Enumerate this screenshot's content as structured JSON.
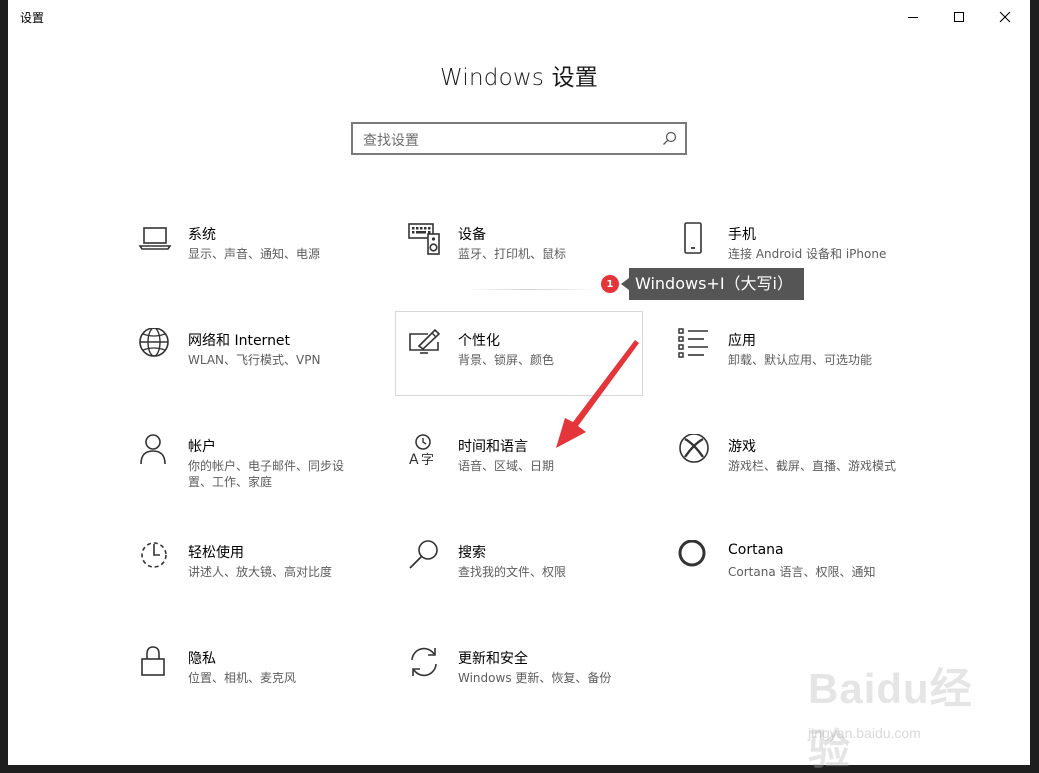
{
  "window": {
    "title": "设置",
    "controls": {
      "minimize": "minimize-icon",
      "maximize": "maximize-icon",
      "close": "close-icon"
    }
  },
  "main": {
    "title": "Windows 设置",
    "search": {
      "placeholder": "查找设置",
      "icon": "search-icon"
    }
  },
  "tiles": [
    {
      "name": "系统",
      "desc": "显示、声音、通知、电源",
      "icon": "laptop-icon"
    },
    {
      "name": "设备",
      "desc": "蓝牙、打印机、鼠标",
      "icon": "keyboard-speaker-icon"
    },
    {
      "name": "手机",
      "desc": "连接 Android 设备和 iPhone",
      "icon": "phone-icon"
    },
    {
      "name": "网络和 Internet",
      "desc": "WLAN、飞行模式、VPN",
      "icon": "globe-icon"
    },
    {
      "name": "个性化",
      "desc": "背景、锁屏、颜色",
      "icon": "paint-monitor-icon"
    },
    {
      "name": "应用",
      "desc": "卸载、默认应用、可选功能",
      "icon": "apps-list-icon"
    },
    {
      "name": "帐户",
      "desc": "你的帐户、电子邮件、同步设置、工作、家庭",
      "icon": "person-icon"
    },
    {
      "name": "时间和语言",
      "desc": "语音、区域、日期",
      "icon": "time-language-icon"
    },
    {
      "name": "游戏",
      "desc": "游戏栏、截屏、直播、游戏模式",
      "icon": "xbox-icon"
    },
    {
      "name": "轻松使用",
      "desc": "讲述人、放大镜、高对比度",
      "icon": "ease-of-access-icon"
    },
    {
      "name": "搜索",
      "desc": "查找我的文件、权限",
      "icon": "search-icon"
    },
    {
      "name": "Cortana",
      "desc": "Cortana 语言、权限、通知",
      "icon": "cortana-icon"
    },
    {
      "name": "隐私",
      "desc": "位置、相机、麦克风",
      "icon": "lock-icon"
    },
    {
      "name": "更新和安全",
      "desc": "Windows 更新、恢复、备份",
      "icon": "sync-icon"
    }
  ],
  "annotation": {
    "badge": "1",
    "text": "Windows+I（大写i）",
    "color": "#e3353a"
  },
  "watermark": {
    "main": "Baidu经验",
    "sub": "jingyan.baidu.com"
  }
}
